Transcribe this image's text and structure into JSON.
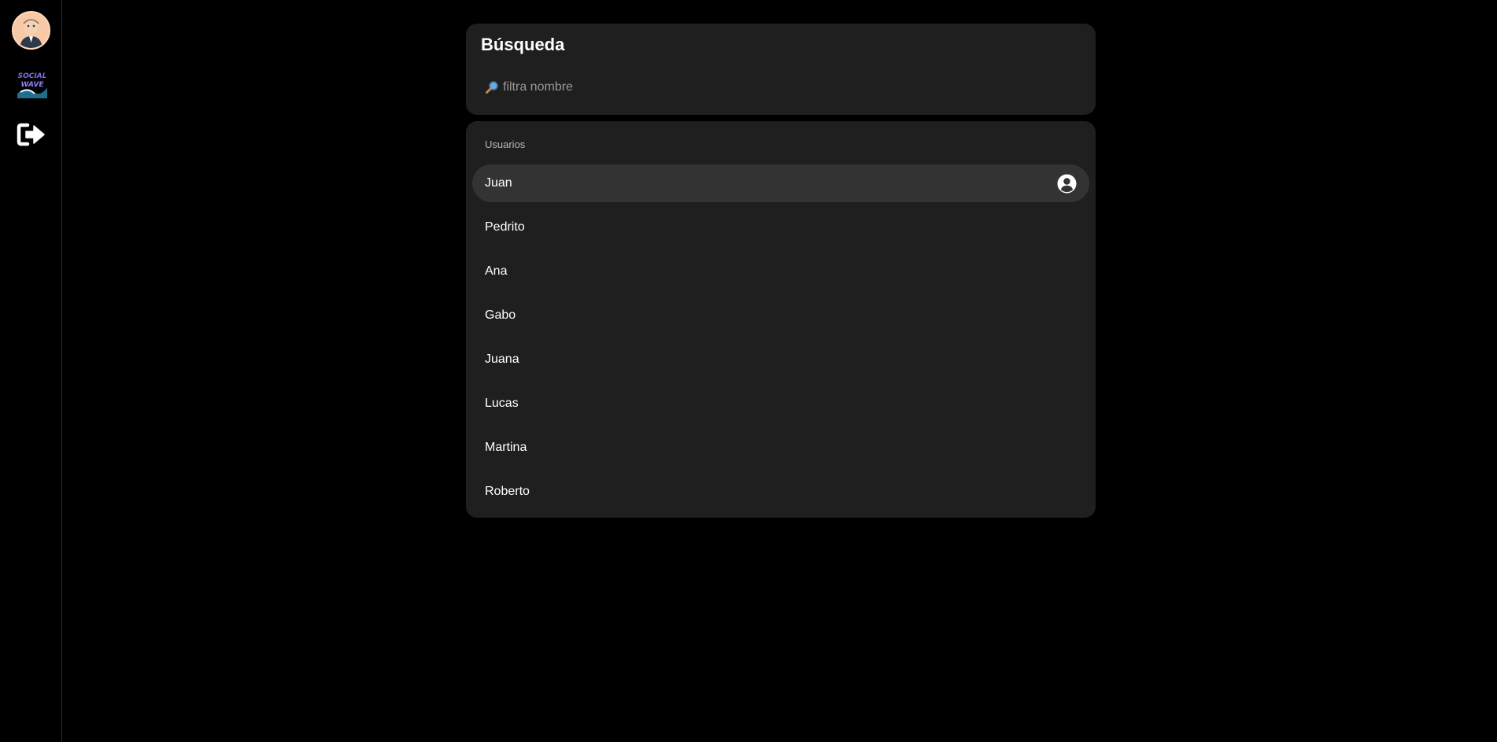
{
  "sidebar": {
    "avatar_icon": "user-avatar-icon",
    "logo_icon": "social-app-logo-icon",
    "logout_icon": "logout-icon"
  },
  "search": {
    "title": "Búsqueda",
    "placeholder": "filtra nombre",
    "value": "",
    "icon": "search-icon"
  },
  "users": {
    "section_label": "Usuarios",
    "selected_index": 0,
    "items": [
      {
        "name": "Juan"
      },
      {
        "name": "Pedrito"
      },
      {
        "name": "Ana"
      },
      {
        "name": "Gabo"
      },
      {
        "name": "Juana"
      },
      {
        "name": "Lucas"
      },
      {
        "name": "Martina"
      },
      {
        "name": "Roberto"
      }
    ]
  },
  "colors": {
    "background": "#000000",
    "panel": "#1f1f1f",
    "selected_row": "#333333",
    "text": "#ffffff",
    "muted_text": "#b8b8b8"
  }
}
